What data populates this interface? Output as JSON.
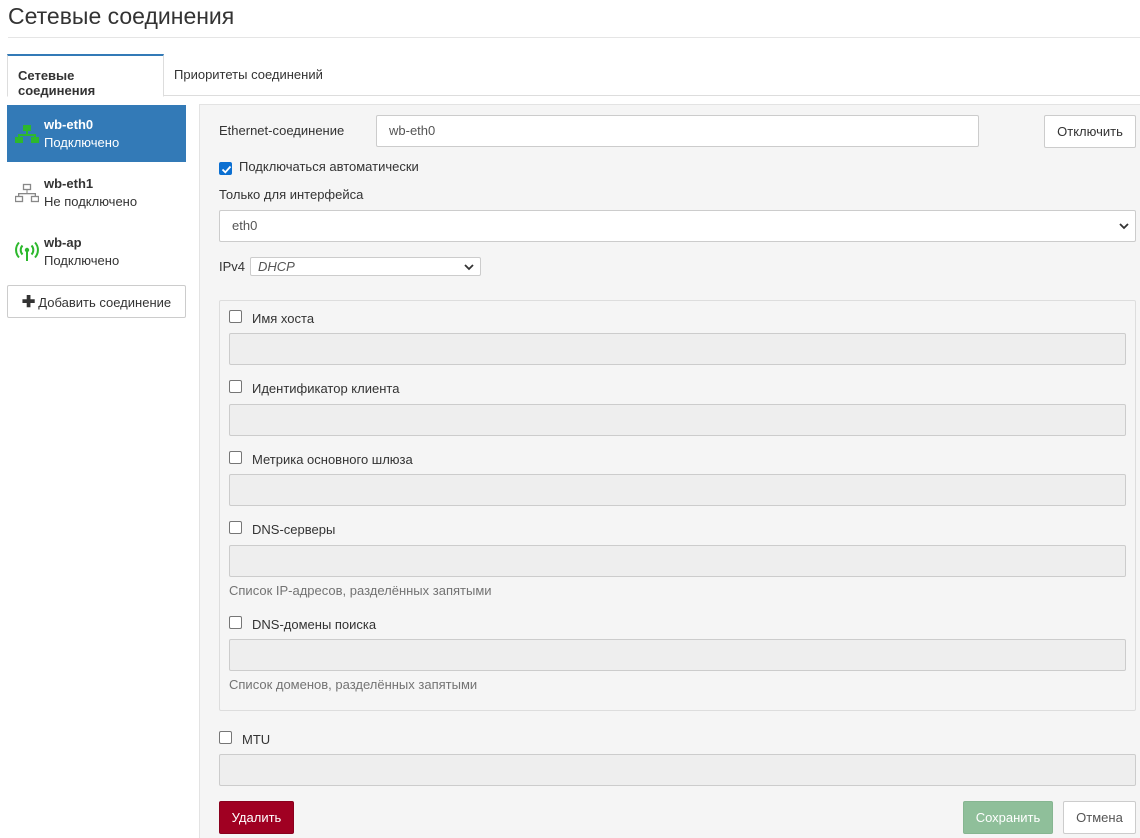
{
  "page": {
    "title": "Сетевые соединения"
  },
  "tabs": [
    {
      "label": "Сетевые соединения",
      "active": true
    },
    {
      "label": "Приоритеты соединений",
      "active": false
    }
  ],
  "connections": [
    {
      "name": "wb-eth0",
      "state": "Подключено",
      "icon": "ethernet-icon",
      "active": true
    },
    {
      "name": "wb-eth1",
      "state": "Не подключено",
      "icon": "ethernet-icon",
      "active": false
    },
    {
      "name": "wb-ap",
      "state": "Подключено",
      "icon": "wifi-ap-icon",
      "active": false
    }
  ],
  "sidebar": {
    "add_label": "Добавить соединение"
  },
  "form": {
    "ethernet_label": "Ethernet-соединение",
    "ethernet_value": "wb-eth0",
    "disconnect_label": "Отключить",
    "autoconnect_label": "Подключаться автоматически",
    "autoconnect_checked": true,
    "interface_label": "Только для интерфейса",
    "interface_value": "eth0",
    "ipv4_label": "IPv4",
    "ipv4_value": "DHCP",
    "hostname_label": "Имя хоста",
    "client_id_label": "Идентификатор клиента",
    "gateway_metric_label": "Метрика основного шлюза",
    "dns_servers_label": "DNS-серверы",
    "dns_servers_help": "Список IP-адресов, разделённых запятыми",
    "dns_search_label": "DNS-домены поиска",
    "dns_search_help": "Список доменов, разделённых запятыми",
    "mtu_label": "MTU",
    "delete_label": "Удалить",
    "save_label": "Сохранить",
    "cancel_label": "Отмена"
  },
  "colors": {
    "accent": "#337ab7",
    "connected_icon": "#2db82d",
    "disconnected_icon": "#888888",
    "delete": "#a00022",
    "save_disabled": "#8fbf9a"
  }
}
